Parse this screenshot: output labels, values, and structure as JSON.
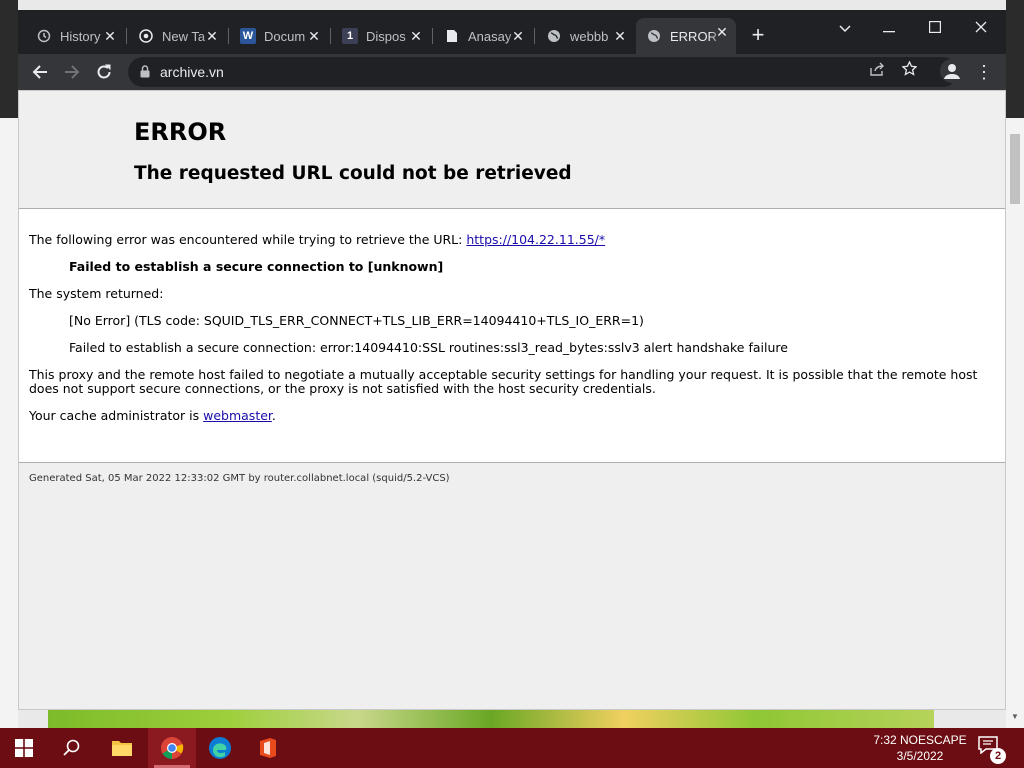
{
  "browser": {
    "tabs": [
      {
        "title": "History",
        "icon": "history-icon"
      },
      {
        "title": "New Ta",
        "icon": "chrome-icon"
      },
      {
        "title": "Docum",
        "icon": "word-icon"
      },
      {
        "title": "Dispos",
        "icon": "number-one-icon",
        "badge": "1"
      },
      {
        "title": "Anasay",
        "icon": "document-icon"
      },
      {
        "title": "webbb",
        "icon": "globe-icon"
      },
      {
        "title": "ERROR",
        "icon": "globe-icon",
        "active": true
      }
    ],
    "url": "archive.vn"
  },
  "page": {
    "heading": "ERROR",
    "subheading": "The requested URL could not be retrieved",
    "intro_text": "The following error was encountered while trying to retrieve the URL: ",
    "intro_link": "https://104.22.11.55/*",
    "failure_message": "Failed to establish a secure connection to [unknown]",
    "system_returned": "The system returned:",
    "tls_code": "[No Error] (TLS code: SQUID_TLS_ERR_CONNECT+TLS_LIB_ERR=14094410+TLS_IO_ERR=1)",
    "ssl_error": "Failed to establish a secure connection: error:14094410:SSL routines:ssl3_read_bytes:sslv3 alert handshake failure",
    "explanation": "This proxy and the remote host failed to negotiate a mutually acceptable security settings for handling your request. It is possible that the remote host does not support secure connections, or the proxy is not satisfied with the host security credentials.",
    "admin_text": "Your cache administrator is ",
    "admin_link": "webmaster",
    "admin_suffix": ".",
    "footer": "Generated Sat, 05 Mar 2022 12:33:02 GMT by router.collabnet.local (squid/5.2-VCS)"
  },
  "taskbar": {
    "time": "7:32 NOESCAPE",
    "date": "3/5/2022",
    "notification_count": "2"
  }
}
